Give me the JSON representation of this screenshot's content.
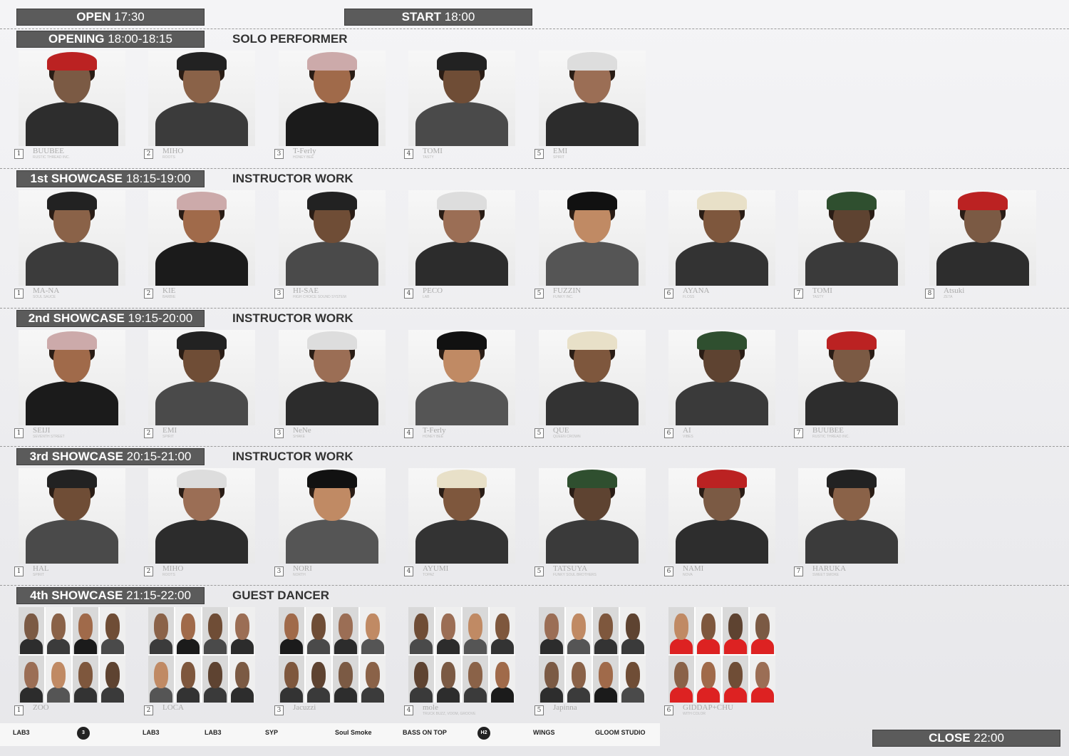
{
  "header": {
    "open_label": "OPEN",
    "open_time": "17:30",
    "start_label": "START",
    "start_time": "18:00"
  },
  "sections": [
    {
      "title": "OPENING",
      "time": "18:00-18:15",
      "subtitle": "SOLO PERFORMER",
      "performers": [
        {
          "num": "1",
          "name": "BUUBEE",
          "team": "RUSTIC THREAD INC."
        },
        {
          "num": "2",
          "name": "MIHO",
          "team": "ROOTS"
        },
        {
          "num": "3",
          "name": "T-Ferly",
          "team": "HONEY BEE"
        },
        {
          "num": "4",
          "name": "TOMI",
          "team": "TASTY"
        },
        {
          "num": "5",
          "name": "EMI",
          "team": "SPIRIT"
        }
      ]
    },
    {
      "title": "1st SHOWCASE",
      "time": "18:15-19:00",
      "subtitle": "INSTRUCTOR WORK",
      "performers": [
        {
          "num": "1",
          "name": "MA-NA",
          "team": "SOUL SAUCE"
        },
        {
          "num": "2",
          "name": "KIE",
          "team": "BARBIE"
        },
        {
          "num": "3",
          "name": "HI-SAE",
          "team": "HIGH CHOICE SOUND SYSTEM"
        },
        {
          "num": "4",
          "name": "PECO",
          "team": "LAB"
        },
        {
          "num": "5",
          "name": "FUZZIN",
          "team": "FUNKY INC."
        },
        {
          "num": "6",
          "name": "AYANA",
          "team": "FLOSS"
        },
        {
          "num": "7",
          "name": "TOMI",
          "team": "TASTY"
        },
        {
          "num": "8",
          "name": "Atsuki",
          "team": "ZETA"
        }
      ]
    },
    {
      "title": "2nd SHOWCASE",
      "time": "19:15-20:00",
      "subtitle": "INSTRUCTOR WORK",
      "performers": [
        {
          "num": "1",
          "name": "SEIJI",
          "team": "SEVENTH STREET"
        },
        {
          "num": "2",
          "name": "EMI",
          "team": "SPIRIT"
        },
        {
          "num": "3",
          "name": "NeNe",
          "team": "SHAKE"
        },
        {
          "num": "4",
          "name": "T-Ferly",
          "team": "HONEY BEE"
        },
        {
          "num": "5",
          "name": "QUE",
          "team": "QUEEN CROWN"
        },
        {
          "num": "6",
          "name": "AI",
          "team": "VIBES"
        },
        {
          "num": "7",
          "name": "BUUBEE",
          "team": "RUSTIC THREAD INC."
        }
      ]
    },
    {
      "title": "3rd SHOWCASE",
      "time": "20:15-21:00",
      "subtitle": "INSTRUCTOR WORK",
      "performers": [
        {
          "num": "1",
          "name": "HAL",
          "team": "SPIRIT"
        },
        {
          "num": "2",
          "name": "MIHO",
          "team": "ROOTS"
        },
        {
          "num": "3",
          "name": "NORI",
          "team": "NORTH"
        },
        {
          "num": "4",
          "name": "AYUMI",
          "team": "TOPAZ"
        },
        {
          "num": "5",
          "name": "TATSUYA",
          "team": "FUNKY SOUL BROTHERS"
        },
        {
          "num": "6",
          "name": "NAMI",
          "team": "NOVA"
        },
        {
          "num": "7",
          "name": "HARUKA",
          "team": "SWEET SMOKE"
        }
      ]
    },
    {
      "title": "4th SHOWCASE",
      "time": "21:15-22:00",
      "subtitle": "GUEST DANCER",
      "performers": [
        {
          "num": "1",
          "name": "ZOO",
          "team": ""
        },
        {
          "num": "2",
          "name": "LOCA",
          "team": ""
        },
        {
          "num": "3",
          "name": "Jacuzzi",
          "team": ""
        },
        {
          "num": "4",
          "name": "mole",
          "team": "TRUCK BUZZ, VOOM, GROOVE"
        },
        {
          "num": "5",
          "name": "Japinna",
          "team": ""
        },
        {
          "num": "6",
          "name": "GIDDAP+CHU",
          "team": "WITH COLOR"
        }
      ]
    }
  ],
  "sponsors": [
    "LAB3",
    "3",
    "LAB3",
    "LAB3",
    "SYP",
    "Soul Smoke",
    "BASS ON TOP",
    "H2",
    "WINGS",
    "GLOOM STUDIO"
  ],
  "footer": {
    "close_label": "CLOSE",
    "close_time": "22:00"
  }
}
